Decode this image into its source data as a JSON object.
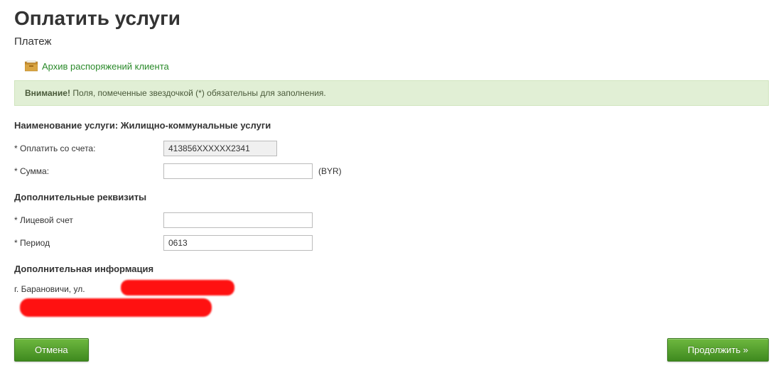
{
  "page": {
    "title": "Оплатить услуги",
    "subtitle": "Платеж"
  },
  "archive": {
    "label": "Архив распоряжений клиента"
  },
  "notice": {
    "strong": "Внимание!",
    "text": " Поля, помеченные звездочкой (*) обязательны для заполнения."
  },
  "service": {
    "label_prefix": "Наименование услуги: ",
    "name": "Жилищно-коммунальные услуги"
  },
  "fields": {
    "account_label": "* Оплатить со счета:",
    "account_value": "413856XXXXXX2341",
    "amount_label": "* Сумма:",
    "amount_value": "",
    "currency": "(BYR)"
  },
  "extra_section": {
    "heading": "Дополнительные реквизиты",
    "personal_account_label": "* Лицевой счет",
    "personal_account_value": "",
    "period_label": "* Период",
    "period_value": "0613"
  },
  "info_section": {
    "heading": "Дополнительная информация",
    "address_prefix": "г. Барановичи, ул."
  },
  "buttons": {
    "cancel": "Отмена",
    "continue": "Продолжить »"
  }
}
